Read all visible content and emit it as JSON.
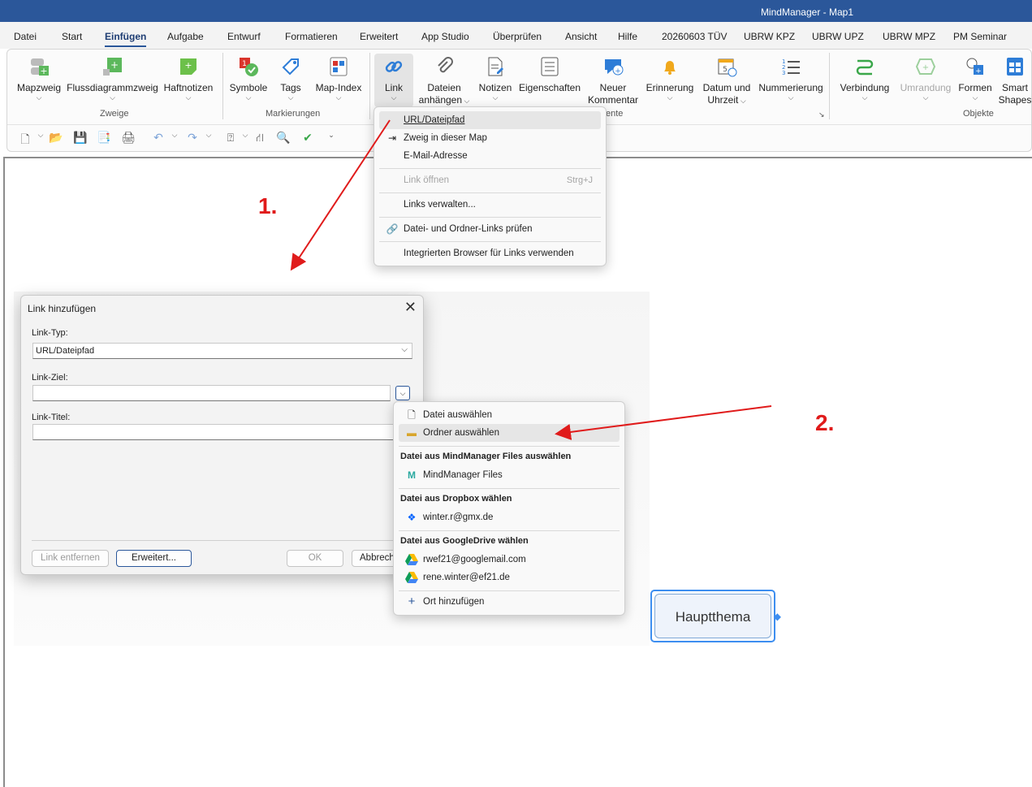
{
  "window": {
    "title": "MindManager - Map1"
  },
  "menu": [
    "Datei",
    "Start",
    "Einfügen",
    "Aufgabe",
    "Entwurf",
    "Formatieren",
    "Erweitert",
    "App Studio",
    "Überprüfen",
    "Ansicht",
    "Hilfe",
    "20260603 TÜV",
    "UBRW KPZ",
    "UBRW UPZ",
    "UBRW MPZ",
    "PM Seminar"
  ],
  "ribbon": {
    "mapzweig": "Mapzweig",
    "flussdiagrammzweig": "Flussdiagrammzweig",
    "haftnotizen": "Haftnotizen",
    "group_zweige": "Zweige",
    "symbole": "Symbole",
    "tags": "Tags",
    "map_index": "Map-Index",
    "group_markierungen": "Markierungen",
    "link": "Link",
    "dateien_l1": "Dateien",
    "dateien_l2": "anhängen",
    "notizen": "Notizen",
    "eigenschaften": "Eigenschaften",
    "kommentar_l1": "Neuer",
    "kommentar_l2": "Kommentar",
    "erinnerung": "Erinnerung",
    "datum_l1": "Datum und",
    "datum_l2": "Uhrzeit",
    "nummerierung": "Nummerierung",
    "group_elemente_partial": "ente",
    "verbindung": "Verbindung",
    "umrandung": "Umrandung",
    "formen": "Formen",
    "smart_l1": "Smart",
    "smart_l2": "Shapes",
    "group_objekte": "Objekte"
  },
  "link_menu": {
    "url": "URL/Dateipfad",
    "zweig": "Zweig in dieser Map",
    "email": "E-Mail-Adresse",
    "open": "Link öffnen",
    "open_shortcut": "Strg+J",
    "manage": "Links verwalten...",
    "check": "Datei- und Ordner-Links prüfen",
    "browser": "Integrierten Browser für Links verwenden"
  },
  "dialog": {
    "title": "Link hinzufügen",
    "link_typ_label": "Link-Typ:",
    "link_typ_value": "URL/Dateipfad",
    "link_ziel_label": "Link-Ziel:",
    "link_ziel_value": "",
    "link_titel_label": "Link-Titel:",
    "link_titel_value": "",
    "btn_remove": "Link entfernen",
    "btn_advanced": "Erweitert...",
    "btn_ok": "OK",
    "btn_cancel": "Abbreche"
  },
  "target_menu": {
    "datei": "Datei auswählen",
    "ordner": "Ordner auswählen",
    "mm_header": "Datei aus MindManager Files auswählen",
    "mm_files": "MindManager Files",
    "dropbox_header": "Datei aus Dropbox wählen",
    "dropbox_account": "winter.r@gmx.de",
    "gdrive_header": "Datei aus GoogleDrive wählen",
    "gdrive_account1": "rwef21@googlemail.com",
    "gdrive_account2": "rene.winter@ef21.de",
    "add_location": "Ort hinzufügen"
  },
  "topic": {
    "label": "Hauptthema"
  },
  "annotations": {
    "step1": "1.",
    "step2": "2."
  },
  "colors": {
    "titlebar": "#2b579a",
    "arrow": "#e01b1b",
    "topic_border": "#3d8ef0"
  }
}
